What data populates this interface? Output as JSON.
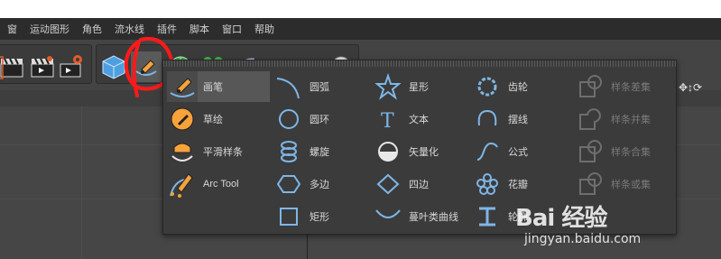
{
  "menu": [
    "窗",
    "运动图形",
    "角色",
    "流水线",
    "插件",
    "脚本",
    "窗口",
    "帮助"
  ],
  "popup": {
    "col1": [
      {
        "label": "画笔",
        "icon": "pen-icon",
        "enabled": true,
        "selected": true
      },
      {
        "label": "草绘",
        "icon": "sketch-icon",
        "enabled": true
      },
      {
        "label": "平滑样条",
        "icon": "smooth-spline-icon",
        "enabled": true
      },
      {
        "label": "Arc Tool",
        "icon": "arc-tool-icon",
        "enabled": true
      }
    ],
    "col2": [
      {
        "label": "圆弧",
        "icon": "arc-icon"
      },
      {
        "label": "圆环",
        "icon": "circle-icon"
      },
      {
        "label": "螺旋",
        "icon": "helix-icon"
      },
      {
        "label": "多边",
        "icon": "polygon-icon"
      },
      {
        "label": "矩形",
        "icon": "rectangle-icon"
      }
    ],
    "col3": [
      {
        "label": "星形",
        "icon": "star-icon"
      },
      {
        "label": "文本",
        "icon": "text-icon"
      },
      {
        "label": "矢量化",
        "icon": "vectorizer-icon"
      },
      {
        "label": "四边",
        "icon": "four-side-icon"
      },
      {
        "label": "蔓叶类曲线",
        "icon": "cissoid-icon"
      }
    ],
    "col4": [
      {
        "label": "齿轮",
        "icon": "cog-icon"
      },
      {
        "label": "摆线",
        "icon": "cycloid-icon"
      },
      {
        "label": "公式",
        "icon": "formula-icon"
      },
      {
        "label": "花瓣",
        "icon": "flower-icon"
      },
      {
        "label": "轮廓",
        "icon": "profile-icon"
      }
    ],
    "col5": [
      {
        "label": "样条差集",
        "icon": "spline-subtract-icon",
        "enabled": false
      },
      {
        "label": "样条并集",
        "icon": "spline-union-icon",
        "enabled": false
      },
      {
        "label": "样条合集",
        "icon": "spline-and-icon",
        "enabled": false
      },
      {
        "label": "样条或集",
        "icon": "spline-or-icon",
        "enabled": false
      }
    ]
  },
  "watermark": {
    "brand": "Bai 经验",
    "url": "jingyan.baidu.com"
  },
  "colors": {
    "accent": "#f7a33a",
    "icon_blue": "#7fb6e6",
    "annotation": "#ff1a1a"
  }
}
